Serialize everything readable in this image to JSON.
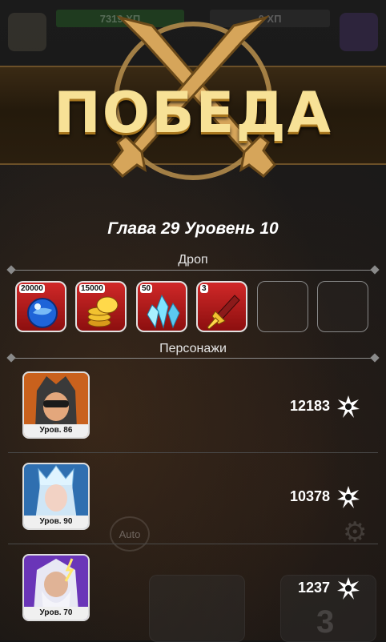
{
  "background": {
    "hp_left": "7319 ХП",
    "hp_right": "0 ХП",
    "auto_label": "Auto",
    "card_number": "3"
  },
  "victory": {
    "title": "ПОБЕДА",
    "level": "Глава 29 Уровень 10"
  },
  "drop": {
    "label": "Дроп",
    "items": [
      {
        "count": "20000",
        "icon": "blue-orb-icon"
      },
      {
        "count": "15000",
        "icon": "gold-coins-icon"
      },
      {
        "count": "50",
        "icon": "crystals-icon"
      },
      {
        "count": "3",
        "icon": "dagger-icon"
      }
    ],
    "empty_slots": 2
  },
  "heroes": {
    "label": "Персонажи",
    "list": [
      {
        "level": "Уров. 86",
        "damage": "12183",
        "portrait": "hooded-rogue"
      },
      {
        "level": "Уров. 90",
        "damage": "10378",
        "portrait": "ice-queen"
      },
      {
        "level": "Уров. 70",
        "damage": "1237",
        "portrait": "storm-god"
      }
    ]
  },
  "colors": {
    "title_gold": "#f7e196",
    "slot_red": "#d02828",
    "banner_brown": "#2a1e0e"
  }
}
